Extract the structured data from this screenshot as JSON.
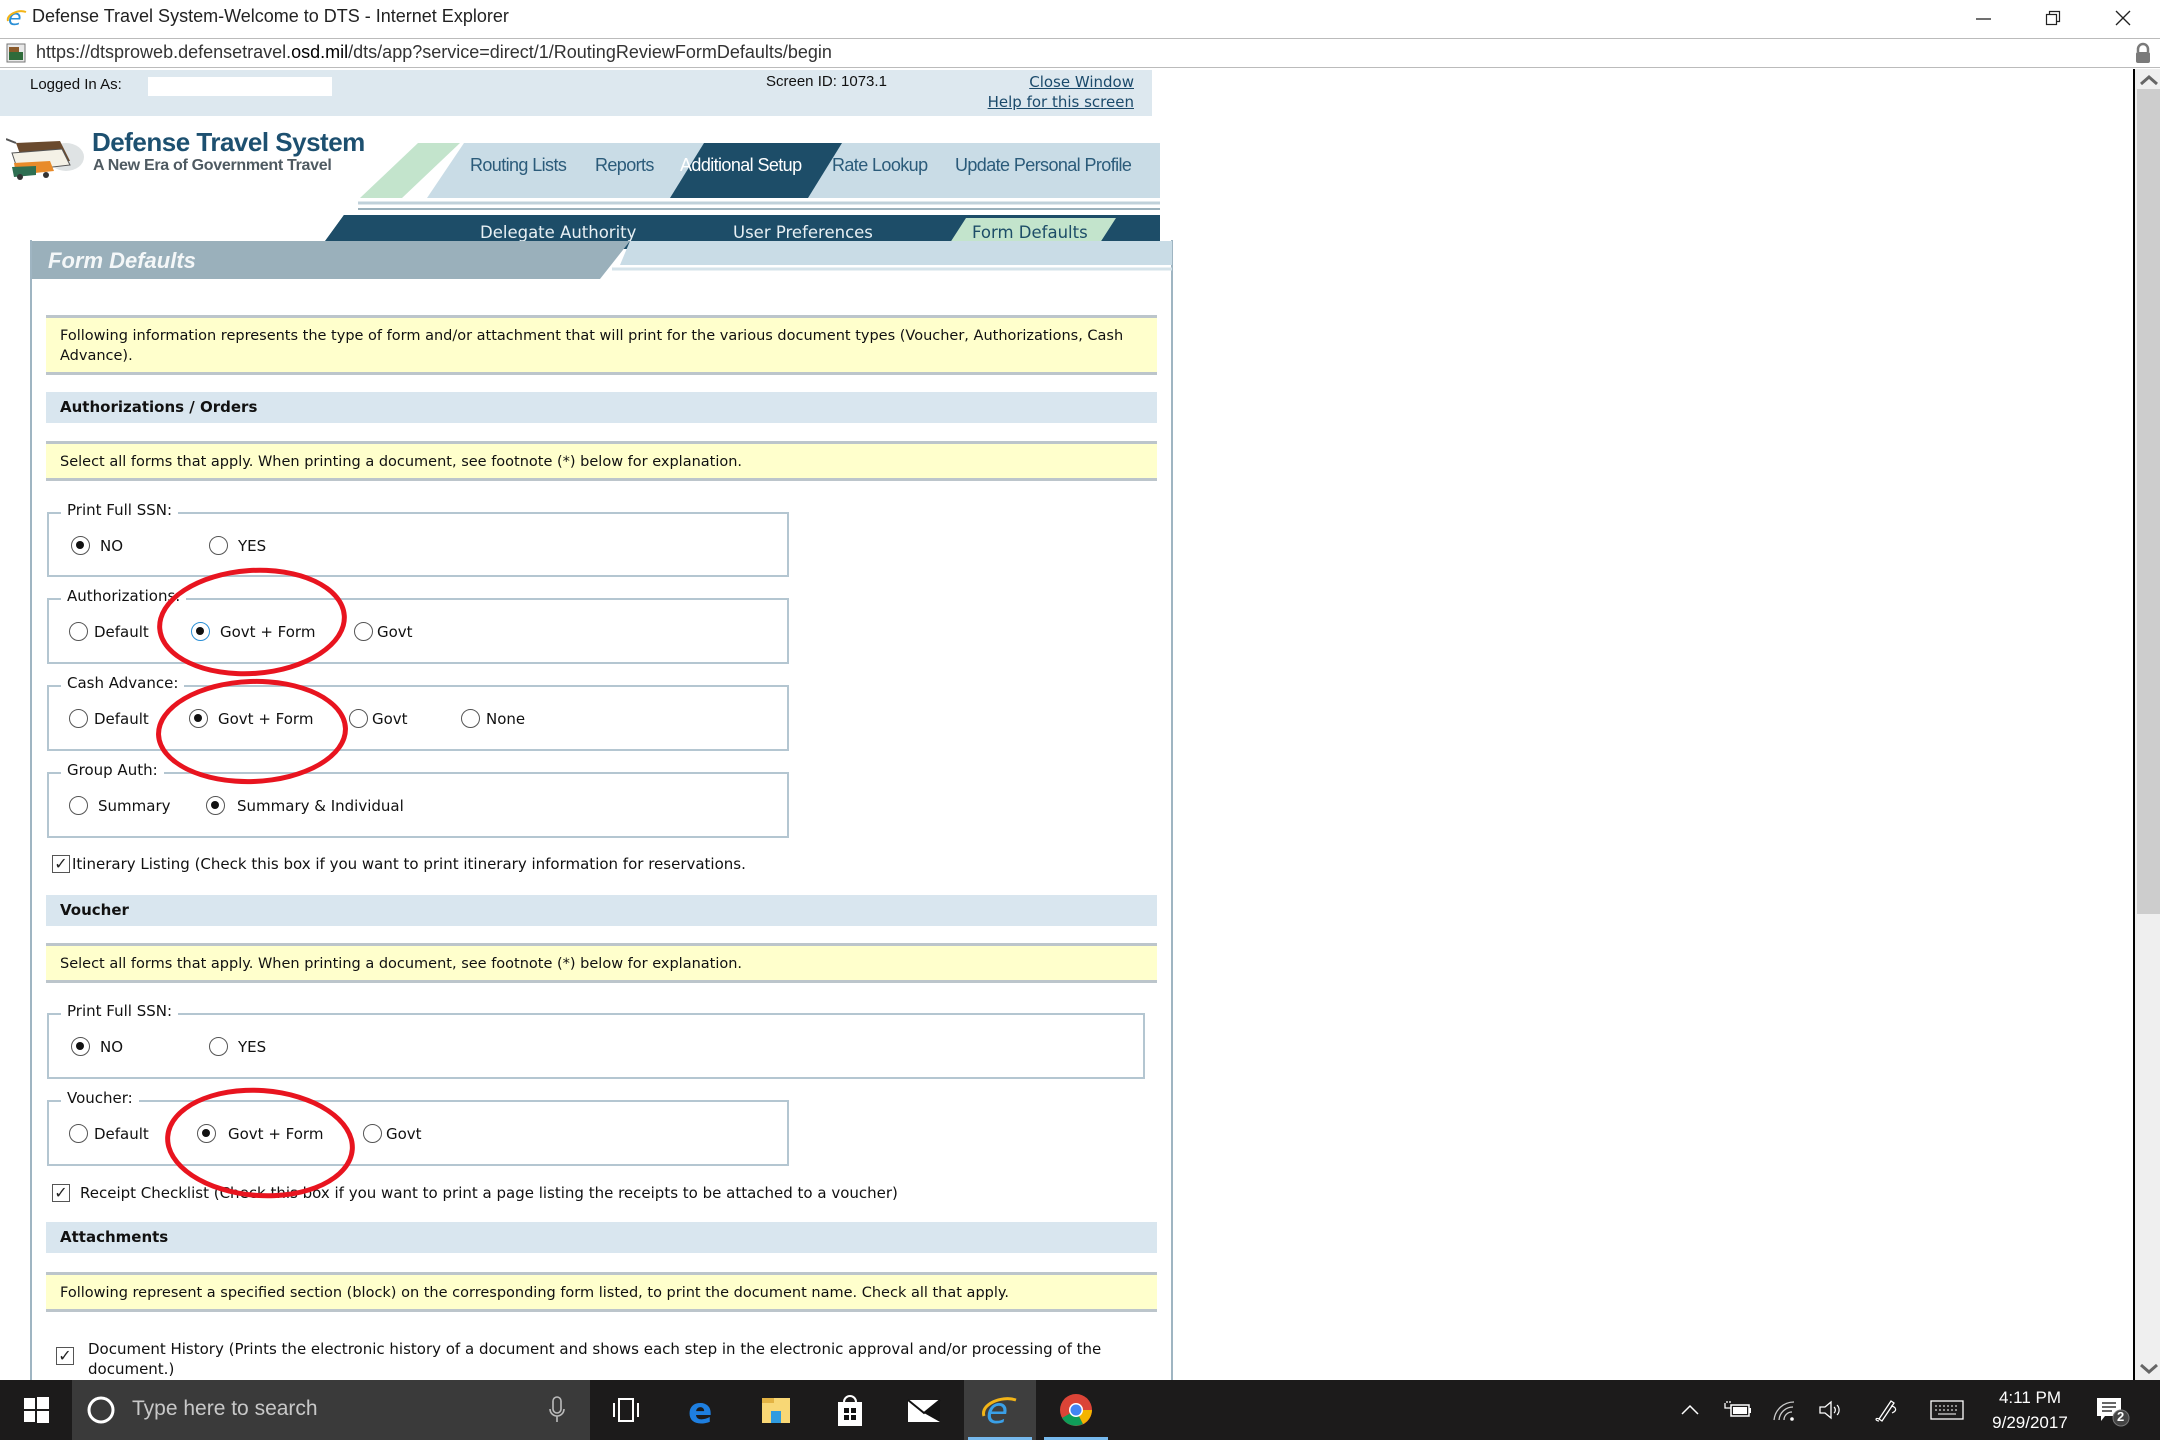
{
  "window": {
    "title": "Defense Travel System-Welcome to DTS - Internet Explorer",
    "url_prefix": "https://dtsproweb.defensetravel.",
    "url_domain": "osd.mil",
    "url_suffix": "/dts/app?service=direct/1/RoutingReviewFormDefaults/begin",
    "controls": [
      "minimize",
      "restore",
      "close"
    ]
  },
  "header": {
    "logged_in_label": "Logged In As:",
    "logged_in_value": "",
    "screen_id": "Screen ID: 1073.1",
    "close_window": "Close Window",
    "help": "Help for this screen"
  },
  "logo": {
    "title": "Defense Travel System",
    "tagline": "A New Era of Government Travel"
  },
  "nav": {
    "primary": [
      {
        "label": "Routing Lists",
        "active": false
      },
      {
        "label": "Reports",
        "active": false
      },
      {
        "label": "Additional Setup",
        "active": true
      },
      {
        "label": "Rate Lookup",
        "active": false
      },
      {
        "label": "Update Personal Profile",
        "active": false
      }
    ],
    "secondary": [
      {
        "label": "Delegate Authority",
        "active": false
      },
      {
        "label": "User Preferences",
        "active": false
      },
      {
        "label": "Form Defaults",
        "active": true
      }
    ]
  },
  "panel": {
    "title": "Form Defaults",
    "intro": "Following information represents the type of form and/or attachment that will print for the various document types (Voucher, Authorizations, Cash Advance).",
    "authorizations_orders": {
      "heading": "Authorizations / Orders",
      "instructions": "Select all forms that apply. When printing a document, see footnote (*) below for explanation.",
      "print_full_ssn": {
        "legend": "Print Full SSN:",
        "options": [
          "NO",
          "YES"
        ],
        "selected": "NO"
      },
      "authorizations": {
        "legend": "Authorizations:",
        "options": [
          "Default",
          "Govt + Form",
          "Govt"
        ],
        "selected": "Govt + Form"
      },
      "cash_advance": {
        "legend": "Cash Advance:",
        "options": [
          "Default",
          "Govt + Form",
          "Govt",
          "None"
        ],
        "selected": "Govt + Form"
      },
      "group_auth": {
        "legend": "Group Auth:",
        "options": [
          "Summary",
          "Summary & Individual"
        ],
        "selected": "Summary & Individual"
      },
      "itinerary": {
        "label": "Itinerary Listing (Check this box if you want to print itinerary information for reservations.",
        "checked": true
      }
    },
    "voucher": {
      "heading": "Voucher",
      "instructions": "Select all forms that apply. When printing a document, see footnote (*) below for explanation.",
      "print_full_ssn": {
        "legend": "Print Full SSN:",
        "options": [
          "NO",
          "YES"
        ],
        "selected": "NO"
      },
      "voucher": {
        "legend": "Voucher:",
        "options": [
          "Default",
          "Govt + Form",
          "Govt"
        ],
        "selected": "Govt + Form"
      },
      "receipt_checklist": {
        "label": "Receipt Checklist (Check this box if you want to print a page listing the receipts to be attached to a voucher)",
        "checked": true
      }
    },
    "attachments": {
      "heading": "Attachments",
      "instructions": "Following represent a specified section (block) on the corresponding form listed, to print the document name. Check all that apply.",
      "document_history": {
        "label": "Document History (Prints the electronic history of a document and shows each step in the electronic approval and/or processing of the document.)",
        "checked": true
      }
    }
  },
  "annotations": {
    "color": "#e8141f",
    "circled": [
      "Authorizations: Govt + Form",
      "Cash Advance: Govt + Form",
      "Voucher: Govt + Form"
    ]
  },
  "taskbar": {
    "search_placeholder": "Type here to search",
    "apps": [
      "task-view",
      "edge",
      "file-explorer",
      "store",
      "mail",
      "internet-explorer",
      "chrome"
    ],
    "time": "4:11 PM",
    "date": "9/29/2017",
    "notification_count": "2"
  },
  "colors": {
    "nav_dark": "#1d4d68",
    "nav_light": "#c9dce6",
    "nav_accent": "#c3e4cc",
    "panel_title": "#9ab0bb",
    "info_yellow": "#ffffcc",
    "section_blue": "#d9e6ef"
  }
}
